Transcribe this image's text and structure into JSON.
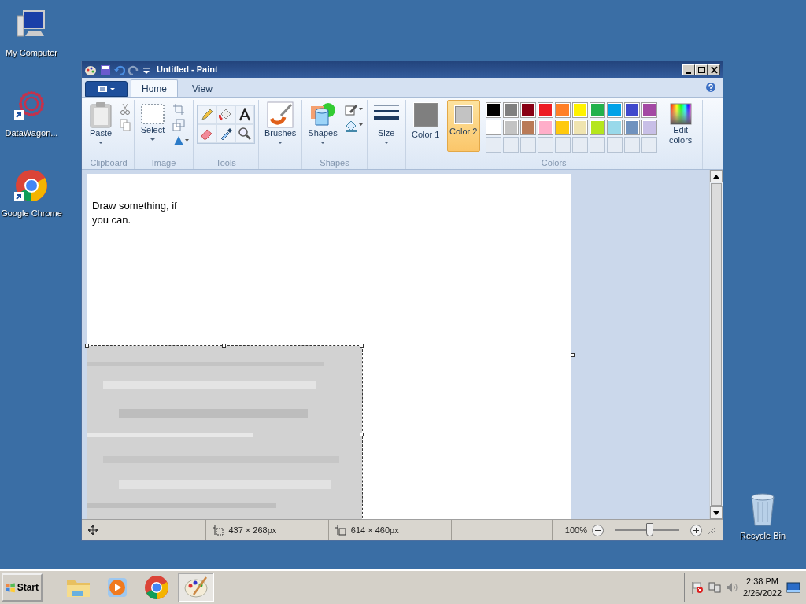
{
  "desktop_icons": [
    {
      "kind": "computer",
      "label": "My Computer"
    },
    {
      "kind": "datawagon",
      "label": "DataWagon..."
    },
    {
      "kind": "chrome",
      "label": "Google Chrome"
    },
    {
      "kind": "recycle",
      "label": "Recycle Bin"
    }
  ],
  "window": {
    "title": "Untitled - Paint"
  },
  "tabs": [
    {
      "label": "Home",
      "selected": true
    },
    {
      "label": "View",
      "selected": false
    }
  ],
  "ribbon": [
    {
      "kind": "clipboard",
      "label": "Clipboard",
      "button": "Paste"
    },
    {
      "label": "Image",
      "button": "Select"
    },
    {
      "kind": "tools",
      "label": "Tools"
    },
    {
      "kind": "brushes",
      "button": "Brushes"
    },
    {
      "kind": "shapes",
      "label": "Shapes",
      "button": "Shapes"
    },
    {
      "kind": "size",
      "button": "Size"
    },
    {
      "kind": "colors",
      "label": "Colors"
    }
  ],
  "colors": {
    "slots": [
      {
        "label": "Color 1",
        "color": "#7f7f7f",
        "selected": false
      },
      {
        "label": "Color 2",
        "color": "#c3c3c3",
        "selected": true
      }
    ],
    "palette": [
      {
        "color": "#000000"
      },
      {
        "color": "#7f7f7f"
      },
      {
        "color": "#880015"
      },
      {
        "color": "#ed1c24"
      },
      {
        "color": "#ff7f27"
      },
      {
        "color": "#fff200"
      },
      {
        "color": "#22b14c"
      },
      {
        "color": "#00a2e8"
      },
      {
        "color": "#3f48cc"
      },
      {
        "color": "#a349a4"
      },
      {
        "color": "#ffffff"
      },
      {
        "color": "#c3c3c3"
      },
      {
        "color": "#b97a57"
      },
      {
        "color": "#ffaec9"
      },
      {
        "color": "#ffc90e"
      },
      {
        "color": "#efe4b0"
      },
      {
        "color": "#b5e61d"
      },
      {
        "color": "#99d9ea"
      },
      {
        "color": "#7092be"
      },
      {
        "color": "#c8bfe7"
      },
      {
        "kind": "empty"
      },
      {
        "kind": "empty"
      },
      {
        "kind": "empty"
      },
      {
        "kind": "empty"
      },
      {
        "kind": "empty"
      },
      {
        "kind": "empty"
      },
      {
        "kind": "empty"
      },
      {
        "kind": "empty"
      },
      {
        "kind": "empty"
      },
      {
        "kind": "empty"
      }
    ],
    "edit_button": "Edit colors"
  },
  "canvas": {
    "text": "Draw something, if you can."
  },
  "status_bar": {
    "selection_size": "437 × 268px",
    "canvas_size": "614 × 460px",
    "zoom": "100%",
    "zoom_level": {
      "level": 0.55
    }
  },
  "taskbar": {
    "start": "Start",
    "apps": [
      {
        "kind": "explorer",
        "selected": false
      },
      {
        "kind": "media",
        "selected": false
      },
      {
        "kind": "chrome",
        "selected": false
      },
      {
        "kind": "paint",
        "selected": true
      }
    ],
    "time": "2:38 PM",
    "date": "2/26/2022"
  }
}
